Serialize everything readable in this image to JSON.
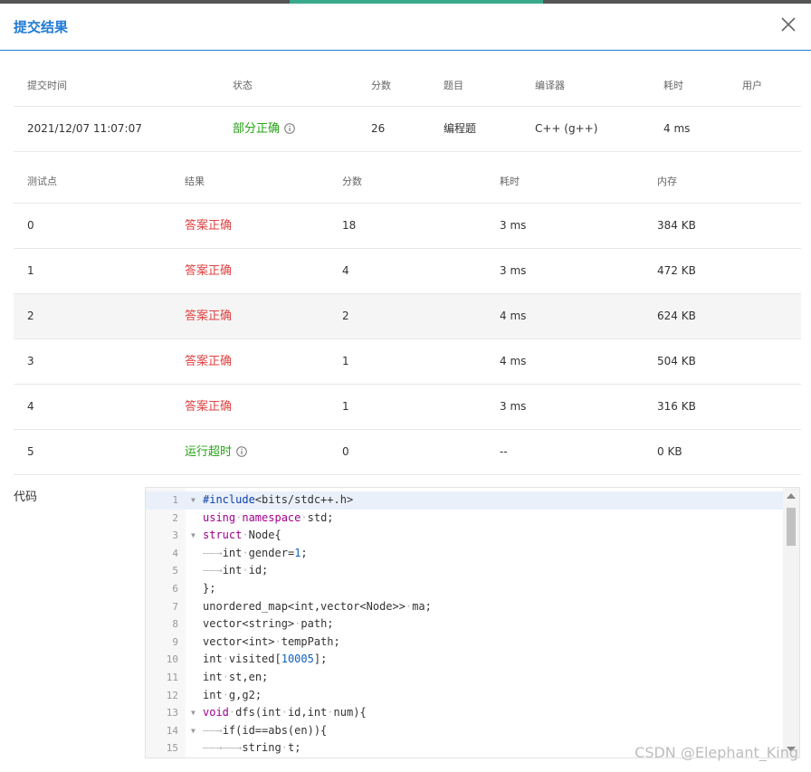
{
  "dialog": {
    "title": "提交结果"
  },
  "summary": {
    "headers": [
      "提交时间",
      "状态",
      "分数",
      "题目",
      "编译器",
      "耗时",
      "用户"
    ],
    "row": {
      "time": "2021/12/07 11:07:07",
      "status": "部分正确",
      "score": "26",
      "problem": "编程题",
      "compiler": "C++ (g++)",
      "duration": "4 ms",
      "user": ""
    }
  },
  "tests": {
    "headers": [
      "测试点",
      "结果",
      "分数",
      "耗时",
      "内存"
    ],
    "rows": [
      {
        "id": "0",
        "result": "答案正确",
        "score": "18",
        "time": "3 ms",
        "memory": "384 KB"
      },
      {
        "id": "1",
        "result": "答案正确",
        "score": "4",
        "time": "3 ms",
        "memory": "472 KB"
      },
      {
        "id": "2",
        "result": "答案正确",
        "score": "2",
        "time": "4 ms",
        "memory": "624 KB"
      },
      {
        "id": "3",
        "result": "答案正确",
        "score": "1",
        "time": "4 ms",
        "memory": "504 KB"
      },
      {
        "id": "4",
        "result": "答案正确",
        "score": "1",
        "time": "3 ms",
        "memory": "316 KB"
      },
      {
        "id": "5",
        "result": "运行超时",
        "score": "0",
        "time": "--",
        "memory": "0 KB"
      }
    ]
  },
  "code": {
    "label": "代码",
    "lines": [
      "#include<bits/stdc++.h>",
      "using·namespace·std;",
      "struct·Node{",
      "——→int·gender=1;",
      "——→int·id;",
      "};",
      "unordered_map<int,vector<Node>>·ma;",
      "vector<string>·path;",
      "vector<int>·tempPath;",
      "int·visited[10005];",
      "int·st,en;",
      "int·g,g2;",
      "void·dfs(int·id,int·num){",
      "——→if(id==abs(en)){",
      "——→——→string·t;"
    ]
  },
  "watermark": "CSDN @Elephant_King",
  "colors": {
    "accent": "#1f7bd6",
    "partial": "#26a316",
    "correct": "#e04242",
    "timeout": "#26a316"
  }
}
